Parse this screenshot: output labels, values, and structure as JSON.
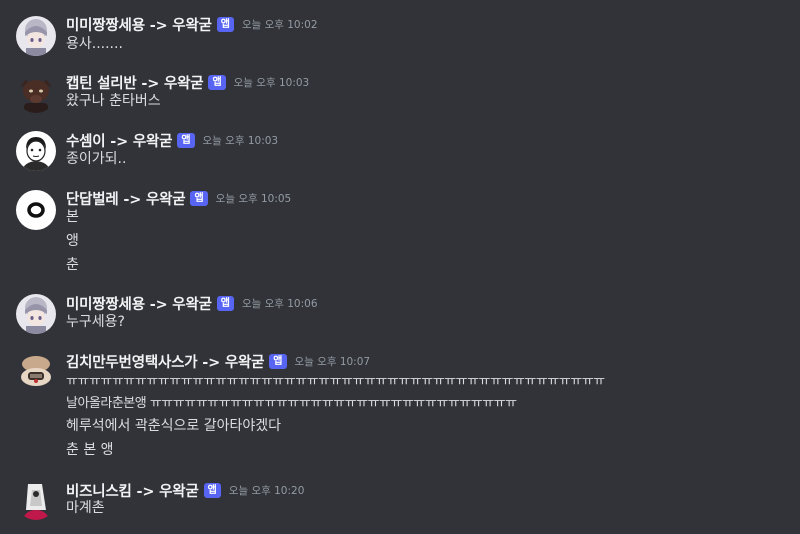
{
  "messages": [
    {
      "author": "미미짱짱세용 -> 우왁굳",
      "badge": "앱",
      "time": "오늘 오후 10:02",
      "lines": [
        "용사......."
      ]
    },
    {
      "author": "캡틴 설리반 -> 우왁굳",
      "badge": "앱",
      "time": "오늘 오후 10:03",
      "lines": [
        "왔구나 춘타버스"
      ]
    },
    {
      "author": "수셈이 -> 우왁굳",
      "badge": "앱",
      "time": "오늘 오후 10:03",
      "lines": [
        "종이가되.."
      ]
    },
    {
      "author": "단답벌레 -> 우왁굳",
      "badge": "앱",
      "time": "오늘 오후 10:05",
      "lines": [
        "본",
        "앵",
        "춘"
      ]
    },
    {
      "author": "미미짱짱세용 -> 우왁굳",
      "badge": "앱",
      "time": "오늘 오후 10:06",
      "lines": [
        "누구세용?"
      ]
    },
    {
      "author": "김치만두번영택사스가 -> 우왁굳",
      "badge": "앱",
      "time": "오늘 오후 10:07",
      "lines": [
        "ㅠㅠㅠㅠㅠㅠㅠㅠㅠㅠㅠㅠㅠㅠㅠㅠㅠㅠㅠㅠㅠㅠㅠㅠㅠㅠㅠㅠㅠㅠㅠㅠㅠㅠㅠㅠㅠㅠㅠㅠㅠㅠㅠㅠㅠㅠㅠ",
        "날아올라춘본앵 ㅠㅠㅠㅠㅠㅠㅠㅠㅠㅠㅠㅠㅠㅠㅠㅠㅠㅠㅠㅠㅠㅠㅠㅠㅠㅠㅠㅠㅠㅠㅠㅠ",
        "헤루석에서 곽춘식으로 갈아타야겠다",
        "춘 본 앵"
      ]
    },
    {
      "author": "비즈니스킴 -> 우왁굳",
      "badge": "앱",
      "time": "오늘 오후 10:20",
      "lines": [
        "마계촌"
      ]
    }
  ],
  "colors": {
    "background": "#313338",
    "author": "#f2f3f5",
    "text": "#dbdee1",
    "timestamp": "#949ba4",
    "badge": "#5865f2"
  }
}
